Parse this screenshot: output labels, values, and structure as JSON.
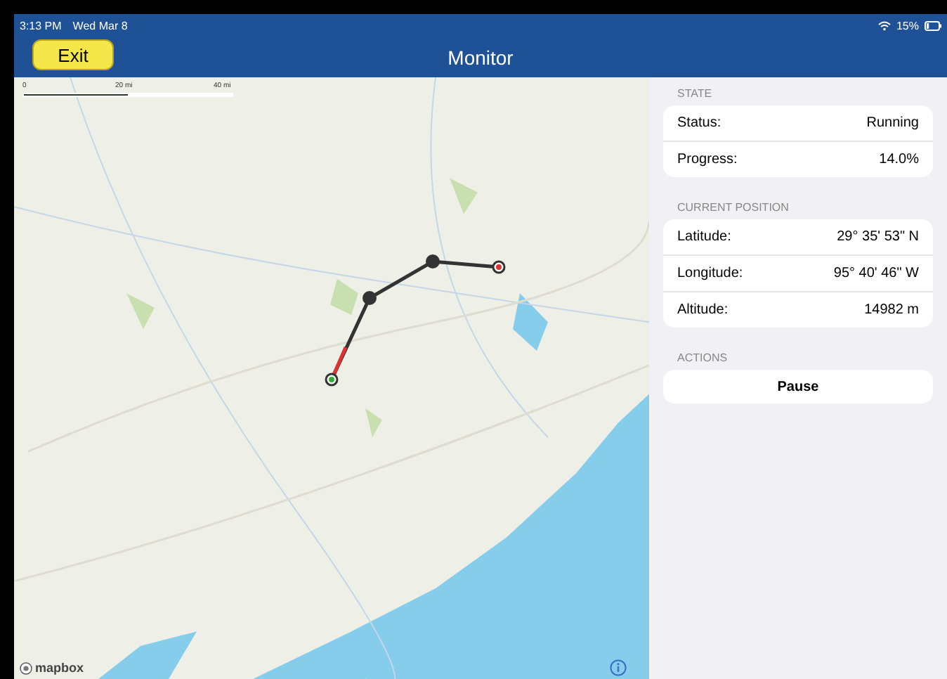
{
  "status_bar": {
    "time": "3:13 PM",
    "date": "Wed Mar 8",
    "battery": "15%"
  },
  "nav_bar": {
    "exit_button": "Exit",
    "title": "Monitor"
  },
  "map": {
    "scale_labels": [
      "0",
      "20 mi",
      "40 mi"
    ],
    "attribution": "mapbox"
  },
  "sections": [
    {
      "header": "STATE",
      "rows": [
        {
          "label": "Status:",
          "value": "Running"
        },
        {
          "label": "Progress:",
          "value": "14.0%"
        }
      ]
    },
    {
      "header": "CURRENT POSITION",
      "rows": [
        {
          "label": "Latitude:",
          "value": "29° 35' 53\" N"
        },
        {
          "label": "Longitude:",
          "value": "95° 40' 46\" W"
        },
        {
          "label": "Altitude:",
          "value": "14982 m"
        }
      ]
    }
  ],
  "actions": {
    "header": "ACTIONS",
    "button": "Pause"
  }
}
